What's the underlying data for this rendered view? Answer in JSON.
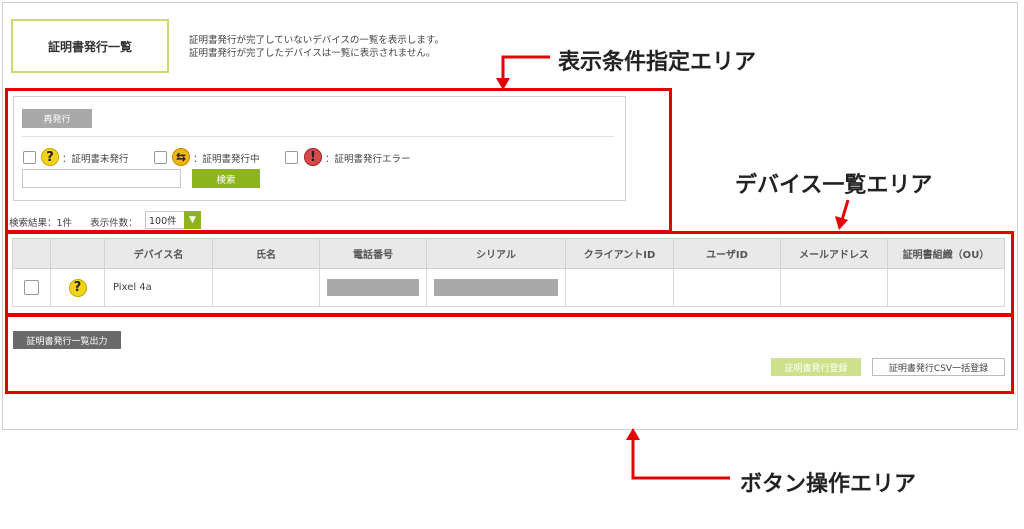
{
  "header": {
    "title": "証明書発行一覧",
    "desc_line1": "証明書発行が完了していないデバイスの一覧を表示します。",
    "desc_line2": "証明書発行が完了したデバイスは一覧に表示されません。"
  },
  "filter": {
    "reissue_label": "再発行",
    "statuses": [
      {
        "label": "：証明書未発行",
        "icon": "question-icon"
      },
      {
        "label": "：証明書発行中",
        "icon": "in-progress-icon"
      },
      {
        "label": "：証明書発行エラー",
        "icon": "error-icon"
      }
    ],
    "search_value": "",
    "search_button": "検索"
  },
  "results": {
    "count_text": "検索結果：1件",
    "per_page_label": "表示件数：",
    "per_page_value": "100件"
  },
  "table": {
    "columns": [
      "",
      "",
      "デバイス名",
      "氏名",
      "電話番号",
      "シリアル",
      "クライアントID",
      "ユーザID",
      "メールアドレス",
      "証明書組織（OU）"
    ],
    "rows": [
      {
        "status_icon": "question-icon",
        "device_name": "Pixel 4a",
        "name": "",
        "phone": "masked",
        "serial": "masked",
        "client_id": "",
        "user_id": "",
        "email": "",
        "ou": ""
      }
    ]
  },
  "actions": {
    "export_label": "証明書発行一覧出力",
    "register_label": "証明書発行登録",
    "csv_label": "証明書発行CSV一括登録"
  },
  "annotations": {
    "filter_area": "表示条件指定エリア",
    "list_area": "デバイス一覧エリア",
    "button_area": "ボタン操作エリア"
  },
  "colors": {
    "accent_green": "#8db51b",
    "highlight_red": "#e50000",
    "title_border": "#c6dc73"
  }
}
